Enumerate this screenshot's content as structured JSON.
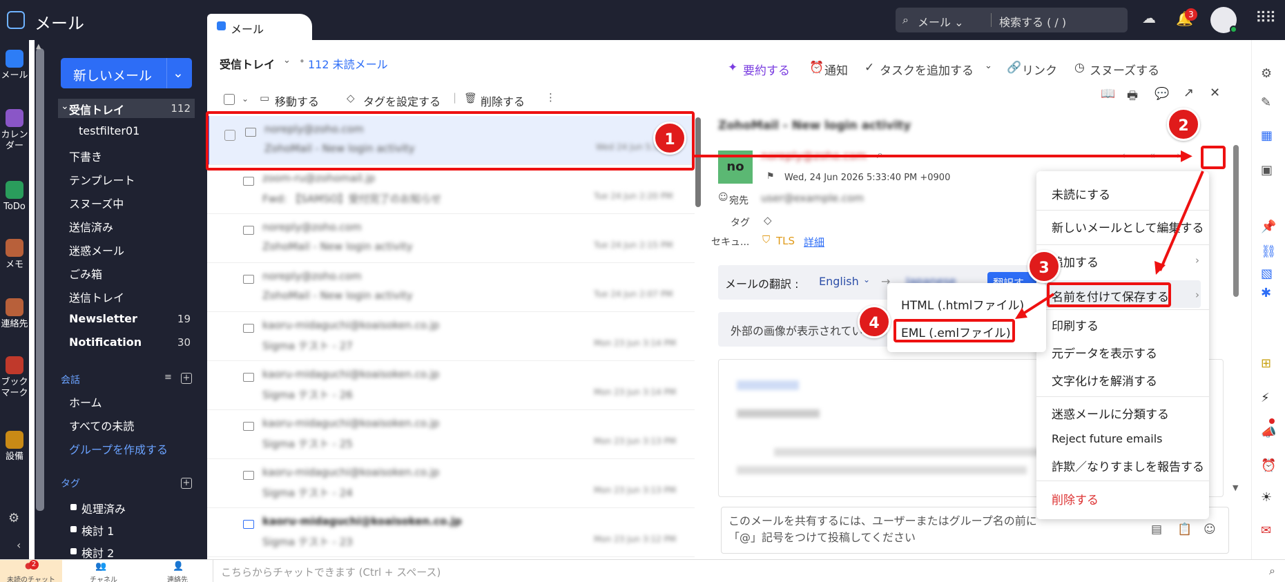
{
  "app": {
    "title": "メール",
    "tab_label": "メール"
  },
  "search": {
    "scope": "メール",
    "placeholder": "検索する ( / )"
  },
  "notifications": {
    "count": "3"
  },
  "rail": [
    {
      "label": "メール",
      "color": "#2d7df6"
    },
    {
      "label": "カレンダー",
      "color": "#8a56c7"
    },
    {
      "label": "ToDo",
      "color": "#2a9d5c"
    },
    {
      "label": "メモ",
      "color": "#b8603a"
    },
    {
      "label": "連絡先",
      "color": "#b8603a"
    },
    {
      "label": "ブックマーク",
      "color": "#c0392b"
    },
    {
      "label": "設備",
      "color": "#c98a16"
    }
  ],
  "folders": {
    "new_mail": "新しいメール",
    "inbox": {
      "label": "受信トレイ",
      "count": "112"
    },
    "items": [
      {
        "label": "testfilter01"
      },
      {
        "label": "下書き"
      },
      {
        "label": "テンプレート"
      },
      {
        "label": "スヌーズ中"
      },
      {
        "label": "送信済み"
      },
      {
        "label": "迷惑メール"
      },
      {
        "label": "ごみ箱"
      },
      {
        "label": "送信トレイ"
      },
      {
        "label": "Newsletter",
        "count": "19"
      },
      {
        "label": "Notification",
        "count": "30"
      }
    ],
    "conversations_heading": "会話",
    "conversations": [
      "ホーム",
      "すべての未読",
      "グループを作成する"
    ],
    "tags_heading": "タグ",
    "tags": [
      "処理済み",
      "検討 1",
      "検討 2"
    ]
  },
  "bottom": {
    "unread_chat": "未読のチャット",
    "unread_chat_count": "2",
    "channels": "チャネル",
    "contacts": "連絡先",
    "chat_placeholder": "こちらからチャットできます (Ctrl + スペース)"
  },
  "list": {
    "folder": "受信トレイ",
    "unread": "112 未読メール",
    "toolbar": {
      "move": "移動する",
      "tag": "タグを設定する",
      "delete": "削除する"
    },
    "rows": [
      {
        "from": "noreply@zoho.com",
        "subject": "ZohoMail - New login activity",
        "date": "Wed 24 Jun 5:33 PM"
      },
      {
        "from": "zoom-ru@zohomail.jp",
        "subject": "Fwd: 【SAMSO】受付完了のお知らせ",
        "date": "Tue 24 Jun 2:20 PM"
      },
      {
        "from": "noreply@zoho.com",
        "subject": "ZohoMail - New login activity",
        "date": "Tue 24 Jun 2:15 PM"
      },
      {
        "from": "noreply@zoho.com",
        "subject": "ZohoMail - New login activity",
        "date": "Tue 24 Jun 2:07 PM"
      },
      {
        "from": "kaoru-midaguchi@koaisoken.co.jp",
        "subject": "Sigma テスト - 27",
        "date": "Mon 23 Jun 3:14 PM"
      },
      {
        "from": "kaoru-midaguchi@koaisoken.co.jp",
        "subject": "Sigma テスト - 26",
        "date": "Mon 23 Jun 3:14 PM"
      },
      {
        "from": "kaoru-midaguchi@koaisoken.co.jp",
        "subject": "Sigma テスト - 25",
        "date": "Mon 23 Jun 3:13 PM"
      },
      {
        "from": "kaoru-midaguchi@koaisoken.co.jp",
        "subject": "Sigma テスト - 24",
        "date": "Mon 23 Jun 3:13 PM"
      },
      {
        "from": "kaoru-midaguchi@koaisoken.co.jp",
        "subject": "Sigma テスト - 23",
        "date": "Mon 23 Jun 3:12 PM"
      }
    ]
  },
  "reader": {
    "toolbar": {
      "summarize": "要約する",
      "notify": "通知",
      "add_task": "タスクを追加する",
      "link": "リンク",
      "snooze": "スヌーズする"
    },
    "subject": "ZohoMail - New login activity",
    "sender_initials": "no",
    "sender": "noreply@zoho.com",
    "date": "Wed, 24 Jun 2026 5:33:40 PM +0900",
    "to_label": "宛先",
    "to": "user@example.com",
    "tag_label": "タグ",
    "security_label": "セキュ...",
    "tls": "TLS",
    "details": "詳細",
    "translate_label": "メールの翻訳 :",
    "from_lang": "English",
    "to_lang": "Japanese",
    "translate_btn": "翻訳す",
    "external_images": "外部の画像が表示されていませ",
    "share_placeholder": "このメールを共有するには、ユーザーまたはグループ名の前に「@」記号をつけて投稿してください"
  },
  "menu": {
    "items": [
      "未読にする",
      "新しいメールとして編集する",
      "追加する",
      "名前を付けて保存する",
      "印刷する",
      "元データを表示する",
      "文字化けを解消する",
      "迷惑メールに分類する",
      "Reject future emails",
      "詐欺／なりすましを報告する",
      "削除する"
    ]
  },
  "submenu": {
    "items": [
      "HTML (.htmlファイル)",
      "EML (.emlファイル)"
    ]
  },
  "callouts": [
    "1",
    "2",
    "3",
    "4"
  ],
  "colors": {
    "accent": "#2d6df6",
    "annotation": "#e01b1b",
    "dark": "#1f2231",
    "selected_row": "#e8effd"
  }
}
